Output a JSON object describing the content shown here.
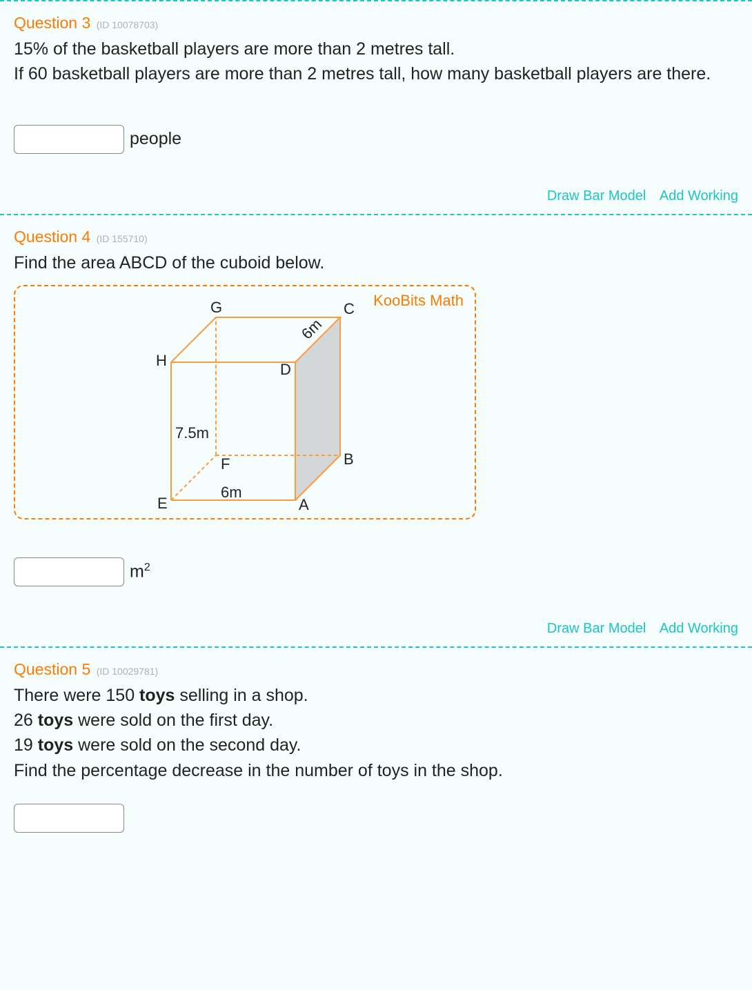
{
  "questions": [
    {
      "title": "Question 3",
      "id_label": "(ID 10078703)",
      "body_lines": [
        "15% of the basketball players are more than 2 metres tall.",
        "If 60 basketball players are more than 2 metres tall, how many basketball players are there."
      ],
      "answer_unit": "people",
      "actions": {
        "draw": "Draw Bar Model",
        "working": "Add Working"
      }
    },
    {
      "title": "Question 4",
      "id_label": "(ID 155710)",
      "body_lines": [
        "Find the area ABCD of the cuboid below."
      ],
      "answer_unit_html": "m²",
      "actions": {
        "draw": "Draw Bar Model",
        "working": "Add Working"
      },
      "diagram": {
        "watermark": "KooBits Math",
        "labels": {
          "G": "G",
          "C": "C",
          "H": "H",
          "D": "D",
          "F": "F",
          "B": "B",
          "E": "E",
          "A": "A"
        },
        "measures": {
          "height": "7.5m",
          "width": "6m",
          "depth": "6m"
        }
      }
    },
    {
      "title": "Question 5",
      "id_label": "(ID 10029781)",
      "body_html": "There were 150 <b>toys</b> selling in a shop.<br>26 <b>toys</b> were sold on the first day.<br>19 <b>toys</b> were sold on the second day.<br>Find the percentage decrease in the number of toys in the shop."
    }
  ]
}
